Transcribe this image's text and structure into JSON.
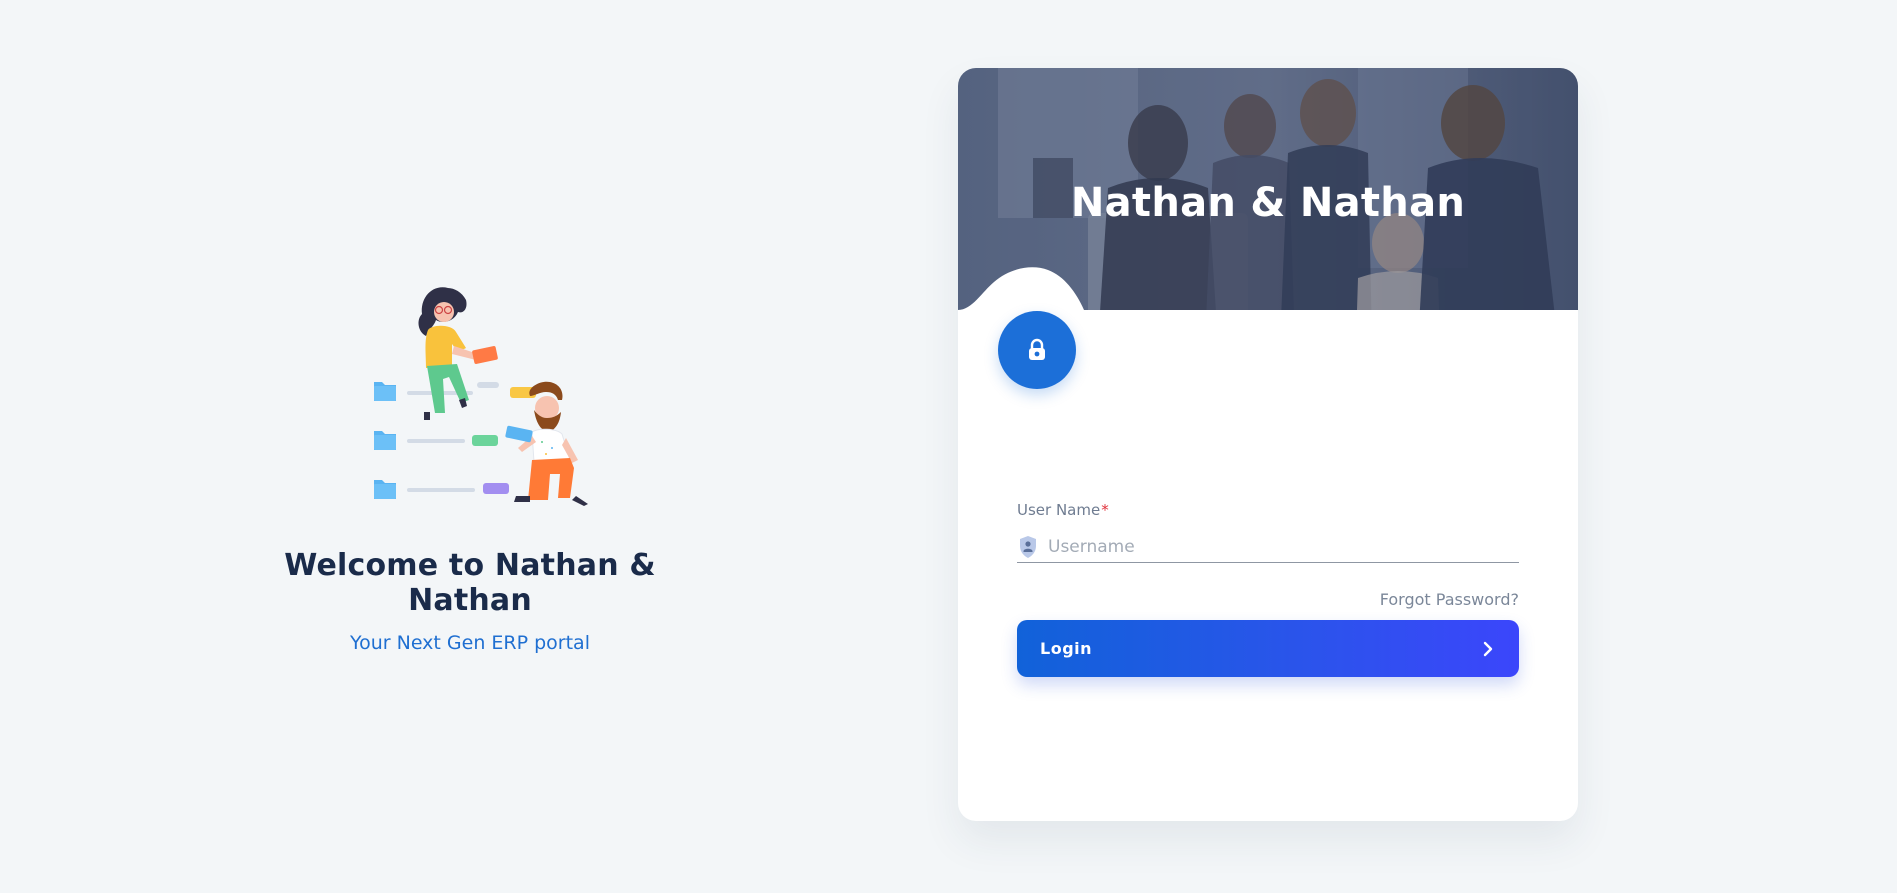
{
  "welcome": {
    "title": "Welcome to Nathan & Nathan",
    "subtitle": "Your Next Gen ERP portal"
  },
  "login_card": {
    "banner_title": "Nathan & Nathan",
    "lock_icon": "lock-icon",
    "username": {
      "label": "User Name",
      "required_mark": "*",
      "placeholder": "Username",
      "value": "",
      "icon": "user-shield-icon"
    },
    "forgot_password": "Forgot Password?",
    "login_button": {
      "label": "Login",
      "icon": "chevron-right-icon"
    }
  },
  "colors": {
    "page_background": "#f3f6f8",
    "primary": "#1c6fd8",
    "button_gradient_start": "#1162d9",
    "button_gradient_end": "#3b46fb",
    "title_text": "#1a2b4a",
    "subtitle_text": "#1f6fd1",
    "required": "#e0323c"
  }
}
